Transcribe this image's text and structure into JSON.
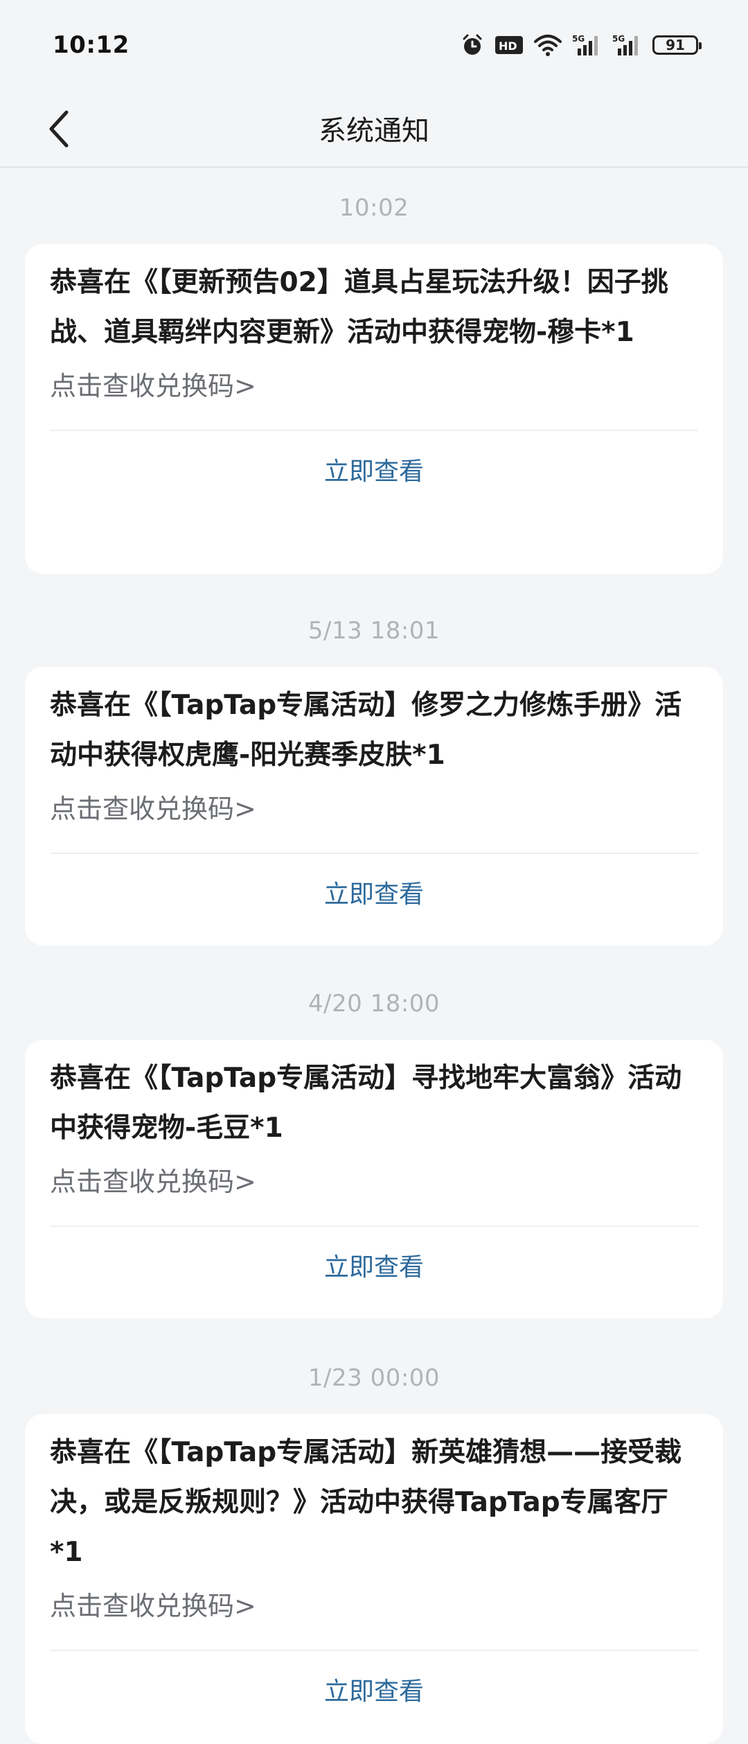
{
  "status_bar": {
    "time": "10:12",
    "battery": "91",
    "icons": [
      "alarm-icon",
      "hd-icon",
      "wifi-icon",
      "5g-signal-icon",
      "5g-signal-icon-2",
      "battery-icon"
    ]
  },
  "header": {
    "title": "系统通知",
    "back_icon": "chevron-left-icon"
  },
  "notifications": [
    {
      "time": "10:02",
      "message": "恭喜在《【更新预告02】道具占星玩法升级！因子挑战、道具羁绊内容更新》活动中获得宠物-穆卡*1",
      "link": "点击查收兑换码>",
      "action": "立即查看"
    },
    {
      "time": "5/13  18:01",
      "message": "恭喜在《【TapTap专属活动】修罗之力修炼手册》活动中获得权虎鹰-阳光赛季皮肤*1",
      "link": "点击查收兑换码>",
      "action": "立即查看"
    },
    {
      "time": "4/20  18:00",
      "message": "恭喜在《【TapTap专属活动】寻找地牢大富翁》活动中获得宠物-毛豆*1",
      "link": "点击查收兑换码>",
      "action": "立即查看"
    },
    {
      "time": "1/23  00:00",
      "message": "恭喜在《【TapTap专属活动】新英雄猜想——接受裁决，或是反叛规则？》活动中获得TapTap专属客厅*1",
      "link": "点击查收兑换码>",
      "action": "立即查看"
    }
  ],
  "colors": {
    "background": "#f4f5f7",
    "card": "#ffffff",
    "action_text": "#2d6a9c",
    "timestamp": "#b0b3b8"
  }
}
